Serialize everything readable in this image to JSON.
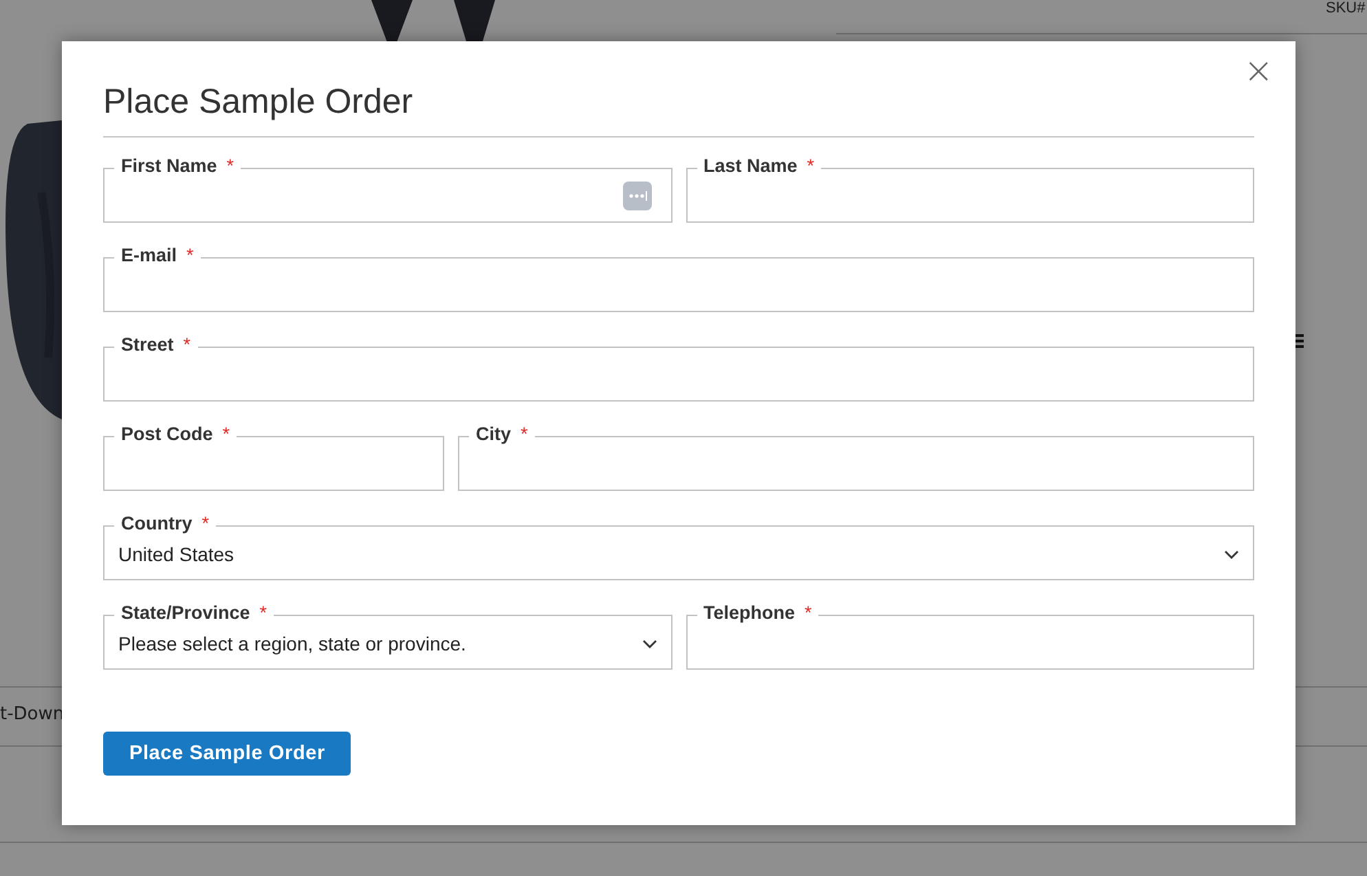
{
  "background_page": {
    "sku_label": "SKU#",
    "tab_label": "t-Down"
  },
  "modal": {
    "title": "Place Sample Order",
    "close_icon": "×",
    "required_mark": "*",
    "rows": [
      {
        "fields": [
          {
            "label": "First Name",
            "kind": "text",
            "required": true,
            "autofill_icon": true
          },
          {
            "label": "Last Name",
            "kind": "text",
            "required": true,
            "autofill_icon": false
          }
        ]
      },
      {
        "fields": [
          {
            "label": "E-mail",
            "kind": "text",
            "required": true,
            "autofill_icon": false
          }
        ]
      },
      {
        "fields": [
          {
            "label": "Street",
            "kind": "text",
            "required": true,
            "autofill_icon": false
          }
        ]
      },
      {
        "fields": [
          {
            "label": "Post Code",
            "kind": "text",
            "required": true,
            "autofill_icon": false
          },
          {
            "label": "City",
            "kind": "text",
            "required": true,
            "autofill_icon": false
          }
        ]
      },
      {
        "fields": [
          {
            "label": "Country",
            "kind": "select",
            "required": true,
            "value": "United States"
          }
        ]
      },
      {
        "fields": [
          {
            "label": "State/Province",
            "kind": "select",
            "required": true,
            "value": "Please select a region, state or province."
          },
          {
            "label": "Telephone",
            "kind": "text",
            "required": true,
            "autofill_icon": false
          }
        ]
      }
    ],
    "submit_button": "Place Sample Order"
  }
}
